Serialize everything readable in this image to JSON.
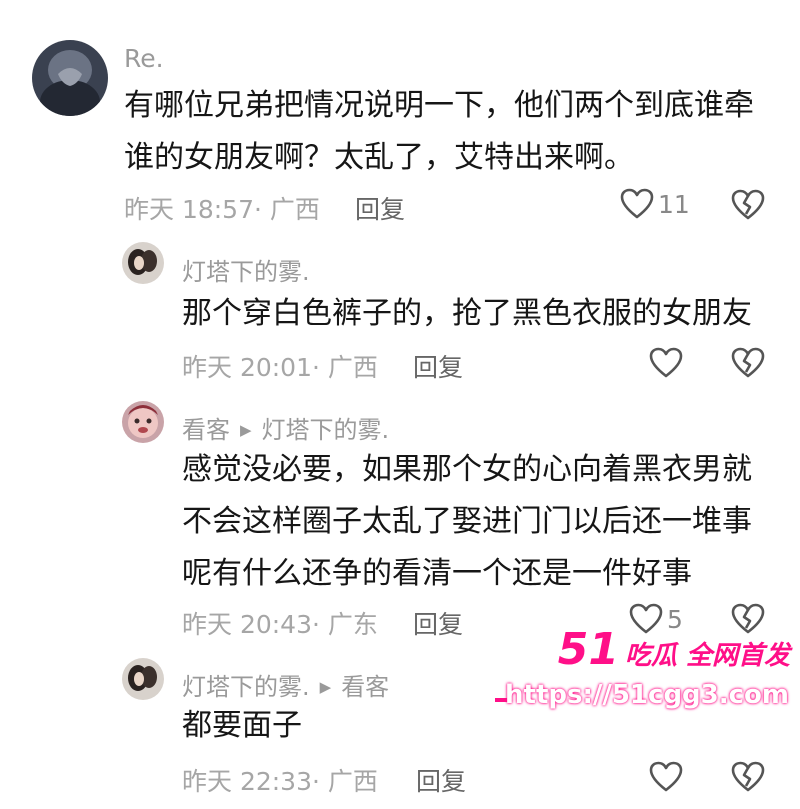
{
  "comments": [
    {
      "user": "Re.",
      "text_lines": [
        "有哪位兄弟把情况说明一下，他们两个到底谁牵",
        "谁的女朋友啊？太乱了，艾特出来啊。"
      ],
      "time": "昨天 18:57· 广西",
      "reply": "回复",
      "likes": "11"
    },
    {
      "user": "灯塔下的雾.",
      "text_lines": [
        "那个穿白色裤子的，抢了黑色衣服的女朋友"
      ],
      "time": "昨天 20:01· 广西",
      "reply": "回复"
    },
    {
      "user": "看客",
      "reply_to": "灯塔下的雾.",
      "text_lines": [
        "感觉没必要，如果那个女的心向着黑衣男就",
        "不会这样圈子太乱了娶进门门以后还一堆事",
        "呢有什么还争的看清一个还是一件好事"
      ],
      "time": "昨天 20:43· 广东",
      "reply": "回复",
      "likes": "5"
    },
    {
      "user": "灯塔下的雾.",
      "reply_to": "看客",
      "text_lines": [
        "都要面子"
      ],
      "time": "昨天 22:33· 广西",
      "reply": "回复"
    }
  ],
  "watermark": {
    "number": "51",
    "tagline": "吃瓜 全网首发",
    "url": "https://51cgg3.com"
  },
  "icons": [
    "heart-icon",
    "broken-heart-icon",
    "play-arrow-icon"
  ],
  "colors": {
    "text": "#161616",
    "meta": "#a6a6a6",
    "watermark": "#ff0f88"
  }
}
